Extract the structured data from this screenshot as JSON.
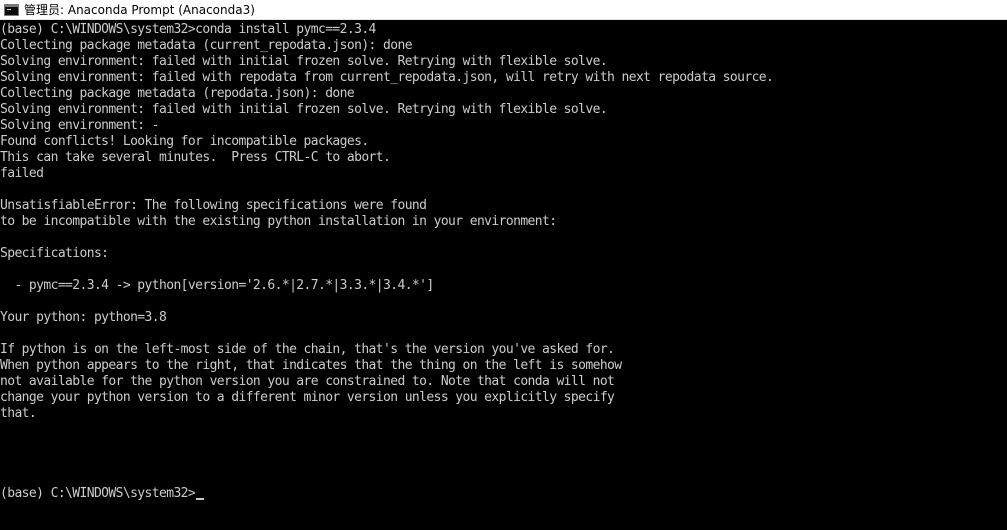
{
  "window": {
    "title": "管理员: Anaconda Prompt (Anaconda3)",
    "icon": "console-icon"
  },
  "colors": {
    "background": "#000000",
    "text": "#cccccc",
    "titlebar": "#ffffff"
  },
  "terminal": {
    "lines": [
      "(base) C:\\WINDOWS\\system32>conda install pymc==2.3.4",
      "Collecting package metadata (current_repodata.json): done",
      "Solving environment: failed with initial frozen solve. Retrying with flexible solve.",
      "Solving environment: failed with repodata from current_repodata.json, will retry with next repodata source.",
      "Collecting package metadata (repodata.json): done",
      "Solving environment: failed with initial frozen solve. Retrying with flexible solve.",
      "Solving environment: -",
      "Found conflicts! Looking for incompatible packages.",
      "This can take several minutes.  Press CTRL-C to abort.",
      "failed",
      "",
      "UnsatisfiableError: The following specifications were found",
      "to be incompatible with the existing python installation in your environment:",
      "",
      "Specifications:",
      "",
      "  - pymc==2.3.4 -> python[version='2.6.*|2.7.*|3.3.*|3.4.*']",
      "",
      "Your python: python=3.8",
      "",
      "If python is on the left-most side of the chain, that's the version you've asked for.",
      "When python appears to the right, that indicates that the thing on the left is somehow",
      "not available for the python version you are constrained to. Note that conda will not",
      "change your python version to a different minor version unless you explicitly specify",
      "that."
    ],
    "prompt": "(base) C:\\WINDOWS\\system32>"
  }
}
